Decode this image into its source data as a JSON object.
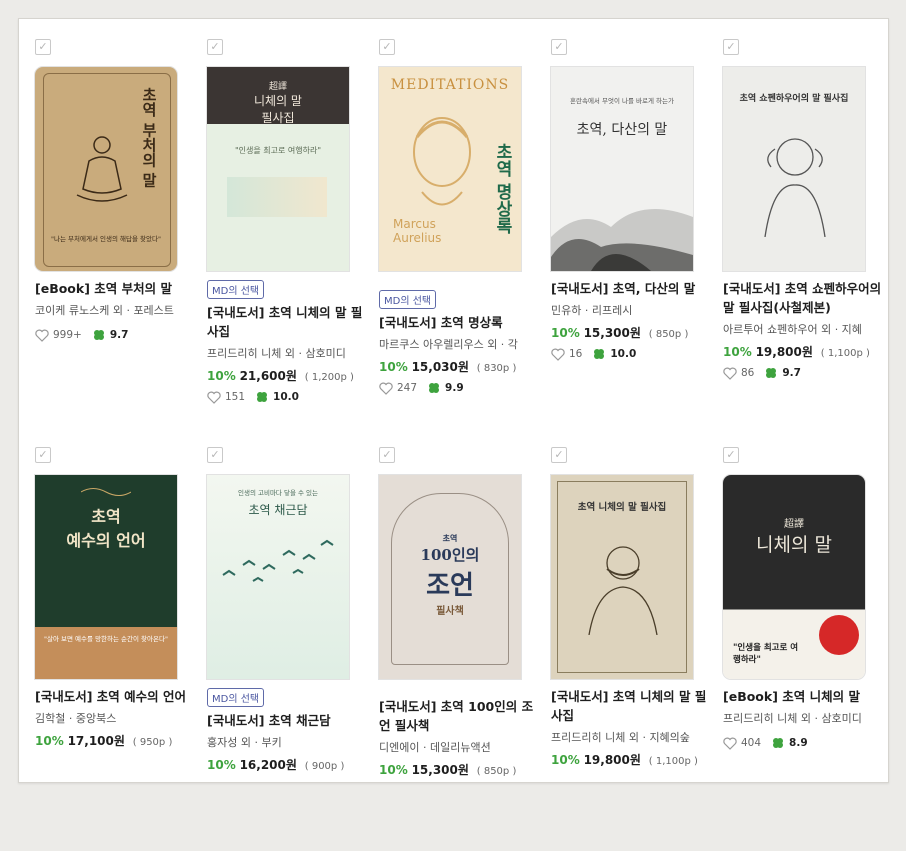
{
  "colors": {
    "discount": "#3ea33e",
    "badge_border": "#5f6aa8",
    "clover": "#3ea33e"
  },
  "books": [
    {
      "cover": {
        "lines": [
          "초역 부처의 말"
        ],
        "sub": "\"나는 부처에게서 인생의 해답을 찾았다\"",
        "bg": "#c9ab7c"
      },
      "badge": "",
      "title": "[eBook] 초역 부처의 말",
      "author": "코이케 류노스케 외 · 포레스트",
      "discount": "",
      "price": "",
      "points": "",
      "hearts": "999+",
      "score": "9.7"
    },
    {
      "cover": {
        "lines": [
          "超譯",
          "니체의 말",
          "필사집"
        ],
        "sub": "\"인생을 최고로 여행하라\"",
        "bg": "#e6efe0"
      },
      "badge": "MD의 선택",
      "title": "[국내도서] 초역 니체의 말 필사집",
      "author": "프리드리히 니체 외 · 삼호미디",
      "discount": "10%",
      "price": "21,600원",
      "points": "( 1,200p )",
      "hearts": "151",
      "score": "10.0"
    },
    {
      "cover": {
        "lines": [
          "MEDITATIONS",
          "초역 명상록"
        ],
        "sub": "Marcus Aurelius",
        "bg": "#f3e6cc"
      },
      "badge": "MD의 선택",
      "title": "[국내도서] 초역 명상록",
      "author": "마르쿠스 아우렐리우스 외 · 각",
      "discount": "10%",
      "price": "15,030원",
      "points": "( 830p )",
      "hearts": "247",
      "score": "9.9"
    },
    {
      "cover": {
        "lines": [
          "초역, 다산의 말"
        ],
        "sub": "혼란속에서 무엇이 나를 바로게 하는가",
        "bg": "#f0f0ee"
      },
      "badge": "",
      "title": "[국내도서] 초역, 다산의 말",
      "author": "민유하 · 리프레시",
      "discount": "10%",
      "price": "15,300원",
      "points": "( 850p )",
      "hearts": "16",
      "score": "10.0"
    },
    {
      "cover": {
        "lines": [
          "초역 쇼펜하우어의 말 필사집"
        ],
        "sub": "",
        "bg": "#ecece8"
      },
      "badge": "",
      "title": "[국내도서] 초역 쇼펜하우어의 말 필사집(사철제본)",
      "author": "아르투어 쇼펜하우어 외 · 지혜",
      "discount": "10%",
      "price": "19,800원",
      "points": "( 1,100p )",
      "hearts": "86",
      "score": "9.7"
    },
    {
      "cover": {
        "lines": [
          "초역",
          "예수의 언어"
        ],
        "sub": "\"살아 보면 예수를 망한하는 순간이 찾아온다\"",
        "bg": "#1f3d2c"
      },
      "badge": "",
      "title": "[국내도서] 초역 예수의 언어",
      "author": "김학철 · 중앙북스",
      "discount": "10%",
      "price": "17,100원",
      "points": "( 950p )",
      "hearts": "",
      "score": ""
    },
    {
      "cover": {
        "lines": [
          "초역 채근담"
        ],
        "sub": "인생의 고비마다 닿을 수 있는",
        "bg": "#e4efe6"
      },
      "badge": "MD의 선택",
      "title": "[국내도서] 초역 채근담",
      "author": "홍자성 외 · 부키",
      "discount": "10%",
      "price": "16,200원",
      "points": "( 900p )",
      "hearts": "",
      "score": ""
    },
    {
      "cover": {
        "lines": [
          "초역",
          "100인의",
          "조언",
          "필사책"
        ],
        "sub": "",
        "bg": "#e4ddd6"
      },
      "badge": "",
      "title": "[국내도서] 초역 100인의 조언 필사책",
      "author": "디엔에이 · 데일리뉴액션",
      "discount": "10%",
      "price": "15,300원",
      "points": "( 850p )",
      "hearts": "",
      "score": ""
    },
    {
      "cover": {
        "lines": [
          "초역 니체의 말 필사집"
        ],
        "sub": "",
        "bg": "#ddd3bd"
      },
      "badge": "",
      "title": "[국내도서] 초역 니체의 말 필사집",
      "author": "프리드리히 니체 외 · 지혜의숲",
      "discount": "10%",
      "price": "19,800원",
      "points": "( 1,100p )",
      "hearts": "",
      "score": ""
    },
    {
      "cover": {
        "lines": [
          "超譯",
          "니체의 말"
        ],
        "sub": "\"인생을 최고로 여행하라\"",
        "bg": "#2a2a2a"
      },
      "badge": "",
      "title": "[eBook] 초역 니체의 말",
      "author": "프리드리히 니체 외 · 삼호미디",
      "discount": "",
      "price": "",
      "points": "",
      "hearts": "404",
      "score": "8.9"
    }
  ]
}
